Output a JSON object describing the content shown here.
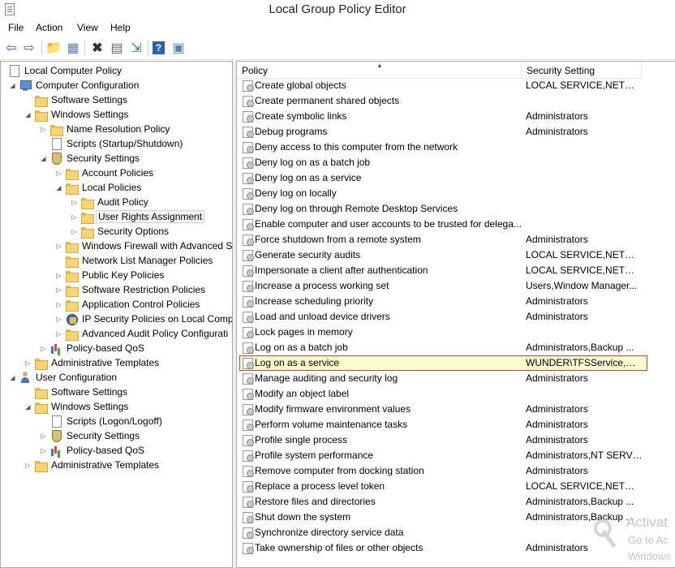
{
  "window": {
    "title": "Local Group Policy Editor"
  },
  "menu": [
    "File",
    "Action",
    "View",
    "Help"
  ],
  "toolbar": {
    "buttons": [
      "back-icon",
      "forward-icon",
      "up-folder-icon",
      "show-hide-tree-icon",
      "delete-icon",
      "properties-icon",
      "export-list-icon",
      "help-icon",
      "show-hide-action-pane-icon"
    ]
  },
  "tree": [
    {
      "label": "Local Computer Policy",
      "icon": "doc-icon",
      "level": 0,
      "expander": ""
    },
    {
      "label": "Computer Configuration",
      "icon": "computer-icon",
      "level": 1,
      "expander": "open"
    },
    {
      "label": "Software Settings",
      "icon": "folder-icon",
      "level": 2,
      "expander": ""
    },
    {
      "label": "Windows Settings",
      "icon": "folder-icon",
      "level": 2,
      "expander": "open"
    },
    {
      "label": "Name Resolution Policy",
      "icon": "folder-icon",
      "level": 3,
      "expander": "closed"
    },
    {
      "label": "Scripts (Startup/Shutdown)",
      "icon": "doc-icon",
      "level": 3,
      "expander": ""
    },
    {
      "label": "Security Settings",
      "icon": "shield-icon",
      "level": 3,
      "expander": "open"
    },
    {
      "label": "Account Policies",
      "icon": "folder-icon",
      "level": 4,
      "expander": "closed"
    },
    {
      "label": "Local Policies",
      "icon": "folder-icon",
      "level": 4,
      "expander": "open"
    },
    {
      "label": "Audit Policy",
      "icon": "folder-lock-icon",
      "level": 5,
      "expander": "closed"
    },
    {
      "label": "User Rights Assignment",
      "icon": "folder-lock-icon",
      "level": 5,
      "expander": "closed",
      "selected": true
    },
    {
      "label": "Security Options",
      "icon": "folder-lock-icon",
      "level": 5,
      "expander": "closed"
    },
    {
      "label": "Windows Firewall with Advanced S",
      "icon": "folder-icon",
      "level": 4,
      "expander": "closed"
    },
    {
      "label": "Network List Manager Policies",
      "icon": "folder-icon",
      "level": 4,
      "expander": ""
    },
    {
      "label": "Public Key Policies",
      "icon": "folder-icon",
      "level": 4,
      "expander": "closed"
    },
    {
      "label": "Software Restriction Policies",
      "icon": "folder-icon",
      "level": 4,
      "expander": "closed"
    },
    {
      "label": "Application Control Policies",
      "icon": "folder-icon",
      "level": 4,
      "expander": "closed"
    },
    {
      "label": "IP Security Policies on Local Comp",
      "icon": "ipsec-icon",
      "level": 4,
      "expander": "closed"
    },
    {
      "label": "Advanced Audit Policy Configurati",
      "icon": "folder-icon",
      "level": 4,
      "expander": "closed"
    },
    {
      "label": "Policy-based QoS",
      "icon": "chart-icon",
      "level": 3,
      "expander": "closed"
    },
    {
      "label": "Administrative Templates",
      "icon": "folder-icon",
      "level": 2,
      "expander": "closed"
    },
    {
      "label": "User Configuration",
      "icon": "user-icon",
      "level": 1,
      "expander": "open"
    },
    {
      "label": "Software Settings",
      "icon": "folder-icon",
      "level": 2,
      "expander": ""
    },
    {
      "label": "Windows Settings",
      "icon": "folder-icon",
      "level": 2,
      "expander": "open"
    },
    {
      "label": "Scripts (Logon/Logoff)",
      "icon": "doc-icon",
      "level": 3,
      "expander": ""
    },
    {
      "label": "Security Settings",
      "icon": "shield-icon",
      "level": 3,
      "expander": "closed"
    },
    {
      "label": "Policy-based QoS",
      "icon": "chart-icon",
      "level": 3,
      "expander": "closed"
    },
    {
      "label": "Administrative Templates",
      "icon": "folder-icon",
      "level": 2,
      "expander": "closed"
    }
  ],
  "columns": {
    "policy": "Policy",
    "setting": "Security Setting"
  },
  "policies": [
    {
      "name": "Create global objects",
      "setting": "LOCAL SERVICE,NETWO..."
    },
    {
      "name": "Create permanent shared objects",
      "setting": ""
    },
    {
      "name": "Create symbolic links",
      "setting": "Administrators"
    },
    {
      "name": "Debug programs",
      "setting": "Administrators"
    },
    {
      "name": "Deny access to this computer from the network",
      "setting": ""
    },
    {
      "name": "Deny log on as a batch job",
      "setting": ""
    },
    {
      "name": "Deny log on as a service",
      "setting": ""
    },
    {
      "name": "Deny log on locally",
      "setting": ""
    },
    {
      "name": "Deny log on through Remote Desktop Services",
      "setting": ""
    },
    {
      "name": "Enable computer and user accounts to be trusted for delega...",
      "setting": ""
    },
    {
      "name": "Force shutdown from a remote system",
      "setting": "Administrators"
    },
    {
      "name": "Generate security audits",
      "setting": "LOCAL SERVICE,NETWO..."
    },
    {
      "name": "Impersonate a client after authentication",
      "setting": "LOCAL SERVICE,NETWO..."
    },
    {
      "name": "Increase a process working set",
      "setting": "Users,Window Manager..."
    },
    {
      "name": "Increase scheduling priority",
      "setting": "Administrators"
    },
    {
      "name": "Load and unload device drivers",
      "setting": "Administrators"
    },
    {
      "name": "Lock pages in memory",
      "setting": ""
    },
    {
      "name": "Log on as a batch job",
      "setting": "Administrators,Backup ..."
    },
    {
      "name": "Log on as a service",
      "setting": "WUNDER\\TFSService,NT...",
      "highlight": true
    },
    {
      "name": "Manage auditing and security log",
      "setting": "Administrators"
    },
    {
      "name": "Modify an object label",
      "setting": ""
    },
    {
      "name": "Modify firmware environment values",
      "setting": "Administrators"
    },
    {
      "name": "Perform volume maintenance tasks",
      "setting": "Administrators"
    },
    {
      "name": "Profile single process",
      "setting": "Administrators"
    },
    {
      "name": "Profile system performance",
      "setting": "Administrators,NT SERVI..."
    },
    {
      "name": "Remove computer from docking station",
      "setting": "Administrators"
    },
    {
      "name": "Replace a process level token",
      "setting": "LOCAL SERVICE,NETWO..."
    },
    {
      "name": "Restore files and directories",
      "setting": "Administrators,Backup ..."
    },
    {
      "name": "Shut down the system",
      "setting": "Administrators,Backup ..."
    },
    {
      "name": "Synchronize directory service data",
      "setting": ""
    },
    {
      "name": "Take ownership of files or other objects",
      "setting": "Administrators"
    }
  ],
  "watermark": {
    "line1": "Activat",
    "line2": "Go to Ac",
    "line3": "Windows"
  }
}
